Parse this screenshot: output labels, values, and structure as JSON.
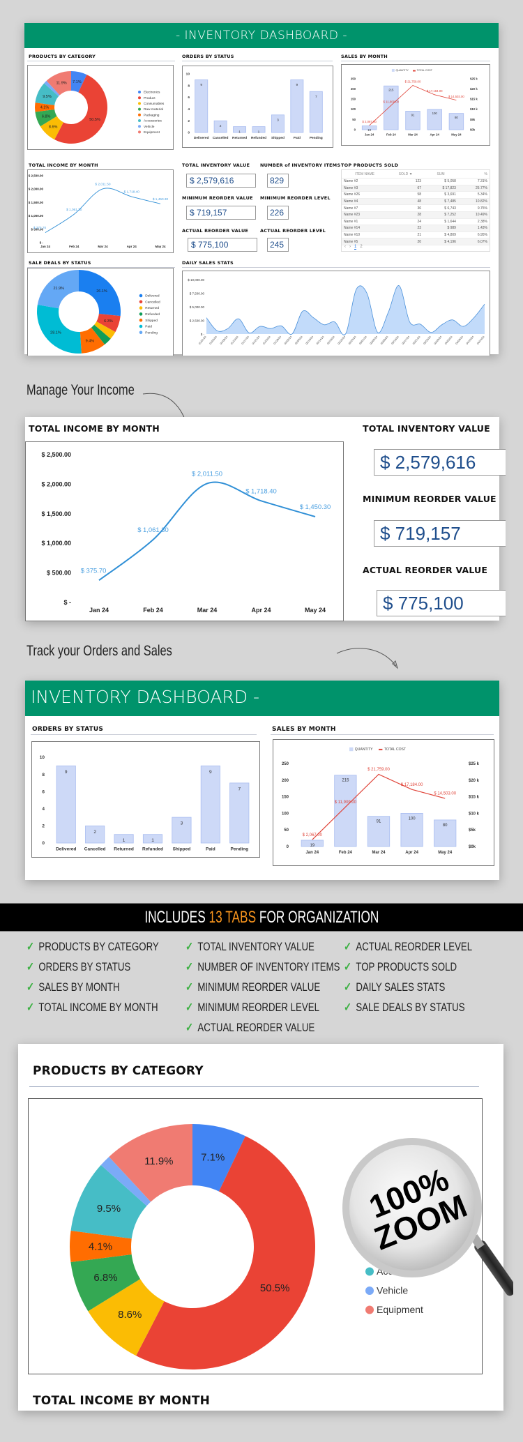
{
  "colors": {
    "brand_green": "#00936b",
    "bar_fill": "#cdd9f7",
    "line_blue": "#2f8fd6",
    "cost_red": "#e0453a",
    "kpi_text": "#1f4e8c",
    "accent_orange": "#f7941d",
    "check_green": "#3cb043"
  },
  "dashboard": {
    "title": "-  INVENTORY DASHBOARD  -",
    "sections": {
      "products_by_category": "PRODUCTS BY CATEGORY",
      "orders_by_status": "ORDERS BY STATUS",
      "sales_by_month": "SALES BY MONTH",
      "total_income_by_month": "TOTAL INCOME BY MONTH",
      "total_inventory_value": "TOTAL INVENTORY VALUE",
      "number_of_inventory_items": "NUMBER of INVENTORY ITEMS",
      "minimum_reorder_value": "MINIMUM REORDER VALUE",
      "minimum_reorder_level": "MINIMUM REORDER LEVEL",
      "actual_reorder_value": "ACTUAL REORDER VALUE",
      "actual_reorder_level": "ACTUAL REORDER LEVEL",
      "top_products_sold": "TOP PRODUCTS SOLD",
      "sale_deals_by_status": "SALE DEALS BY STATUS",
      "daily_sales_stats": "DAILY SALES STATS"
    },
    "kpis": {
      "total_inventory_value": "$ 2,579,616",
      "number_of_inventory_items": "829",
      "minimum_reorder_value": "$ 719,157",
      "minimum_reorder_level": "226",
      "actual_reorder_value": "$ 775,100",
      "actual_reorder_level": "245"
    },
    "top_products": {
      "headers": [
        "ITEM NAME",
        "SOLD ▼",
        "SUM",
        "%"
      ],
      "rows": [
        [
          "Name #2",
          "123",
          "$ 5,058",
          "7.31%"
        ],
        [
          "Name #3",
          "67",
          "$ 17,823",
          "25.77%"
        ],
        [
          "Name #26",
          "58",
          "$ 3,691",
          "5.34%"
        ],
        [
          "Name #4",
          "48",
          "$ 7,485",
          "10.82%"
        ],
        [
          "Name #7",
          "36",
          "$ 6,743",
          "9.75%"
        ],
        [
          "Name #23",
          "28",
          "$ 7,252",
          "10.49%"
        ],
        [
          "Name #1",
          "24",
          "$ 1,644",
          "2.38%"
        ],
        [
          "Name #14",
          "23",
          "$ 989",
          "1.43%"
        ],
        [
          "Name #10",
          "21",
          "$ 4,809",
          "6.95%"
        ],
        [
          "Name #5",
          "20",
          "$ 4,196",
          "6.07%"
        ]
      ],
      "pagination": {
        "prev": "‹",
        "next": "›",
        "pages": [
          "1",
          "2"
        ],
        "current": "1"
      }
    }
  },
  "promo": {
    "manage_caption": "Manage Your Income",
    "track_caption": "Track your Orders and Sales",
    "zoom_title": "INVENTORY DASHBOARD  -",
    "banner": {
      "prefix": "INCLUDES ",
      "highlight": "13 TABS",
      "suffix": " FOR ORGANIZATION"
    },
    "features": [
      [
        "PRODUCTS BY CATEGORY",
        "ORDERS BY STATUS",
        "SALES BY MONTH",
        "TOTAL INCOME BY MONTH"
      ],
      [
        "TOTAL INVENTORY VALUE",
        "NUMBER OF INVENTORY ITEMS",
        "MINIMUM REORDER VALUE",
        "MINIMUM REORDER LEVEL",
        "ACTUAL REORDER VALUE"
      ],
      [
        "ACTUAL REORDER LEVEL",
        "TOP PRODUCTS SOLD",
        "DAILY SALES STATS",
        "SALE DEALS BY STATUS"
      ]
    ],
    "check_glyph": "✓",
    "badge": {
      "line1": "100%",
      "line2": "ZOOM"
    },
    "bottom_title": "TOTAL INCOME BY MONTH"
  },
  "chart_data": [
    {
      "id": "products_by_category",
      "type": "pie",
      "donut": true,
      "title": "PRODUCTS BY CATEGORY",
      "legend_position": "right",
      "categories": [
        "Electronics",
        "Product",
        "Consumables",
        "Raw material",
        "Packaging",
        "Accessories",
        "Vehicle",
        "Equipment"
      ],
      "values": [
        7.1,
        50.5,
        8.6,
        6.8,
        4.1,
        9.5,
        1.5,
        11.9
      ],
      "labels": [
        "7.1%",
        "50.5%",
        "8.6%",
        "6.8%",
        "4.1%",
        "9.5%",
        "",
        "11.9%"
      ],
      "colors": [
        "#4285f4",
        "#ea4335",
        "#fbbc04",
        "#34a853",
        "#ff6d01",
        "#46bdc6",
        "#7baaf7",
        "#f07b72"
      ]
    },
    {
      "id": "orders_by_status",
      "type": "bar",
      "title": "ORDERS BY STATUS",
      "categories": [
        "Delivered",
        "Cancelled",
        "Returned",
        "Refunded",
        "Shipped",
        "Paid",
        "Pending"
      ],
      "values": [
        9,
        2,
        1,
        1,
        3,
        9,
        7
      ],
      "yticks": [
        "0",
        "2",
        "4",
        "6",
        "8",
        "10"
      ],
      "ylim": [
        0,
        10
      ]
    },
    {
      "id": "sales_by_month",
      "type": "bar",
      "title": "SALES BY MONTH",
      "categories": [
        "Jan 24",
        "Feb 24",
        "Mar 24",
        "Apr 24",
        "May 24"
      ],
      "series": [
        {
          "name": "QUANTITY",
          "type": "bar",
          "values": [
            19,
            215,
            91,
            100,
            80
          ],
          "labels": [
            "19",
            "215",
            "91",
            "100",
            "80"
          ]
        },
        {
          "name": "TOTAL COST",
          "type": "line",
          "values": [
            2067,
            11909,
            21759,
            17184,
            14503
          ],
          "labels": [
            "$ 2,067.00",
            "$ 11,909.00",
            "$ 21,759.00",
            "$ 17,184.00",
            "$ 14,503.00"
          ]
        }
      ],
      "yticks_left": [
        "0",
        "50",
        "100",
        "150",
        "200",
        "250"
      ],
      "ylim_left": [
        0,
        250
      ],
      "yticks_right": [
        "$0k",
        "$5k",
        "$10 k",
        "$15 k",
        "$20 k",
        "$25 k"
      ],
      "ylim_right": [
        0,
        25000
      ],
      "legend_position": "top"
    },
    {
      "id": "total_income_by_month",
      "type": "line",
      "title": "TOTAL INCOME BY MONTH",
      "categories": [
        "Jan 24",
        "Feb 24",
        "Mar 24",
        "Apr 24",
        "May 24"
      ],
      "values": [
        375.7,
        1061.3,
        2011.5,
        1718.4,
        1450.3
      ],
      "labels": [
        "$ 375.70",
        "$ 1,061.30",
        "$ 2,011.50",
        "$ 1,718.40",
        "$ 1,450.30"
      ],
      "yticks": [
        "$ -",
        "$ 500.00",
        "$ 1,000.00",
        "$ 1,500.00",
        "$ 2,000.00",
        "$ 2,500.00"
      ],
      "ylim": [
        0,
        2500
      ]
    },
    {
      "id": "sale_deals_by_status",
      "type": "pie",
      "donut": true,
      "title": "SALE DEALS BY STATUS",
      "legend_position": "right",
      "categories": [
        "Delivered",
        "Cancelled",
        "Returned",
        "Refunded",
        "Shipped",
        "Paid",
        "Pending"
      ],
      "values": [
        26.1,
        6.3,
        3.1,
        3.1,
        9.4,
        28.1,
        21.9
      ],
      "labels": [
        "26.1%",
        "6.3%",
        "",
        "",
        "9.4%",
        "28.1%",
        "21.9%"
      ],
      "colors": [
        "#1a7ff0",
        "#ea4335",
        "#fbbc04",
        "#0f9d58",
        "#ff6d01",
        "#00bcd4",
        "#64a8f5"
      ]
    },
    {
      "id": "daily_sales_stats",
      "type": "area",
      "title": "DAILY SALES STATS",
      "values": [
        3000,
        600,
        1000,
        2800,
        200,
        1400,
        1000,
        1500,
        0,
        4200,
        3000,
        1700,
        2200,
        0,
        8200,
        7500,
        300,
        4000,
        8900,
        2200,
        1800,
        300,
        1700,
        2600,
        1400,
        3000,
        5500
      ],
      "x": [
        "01/01/24",
        "01/05/24",
        "01/09/24",
        "01/13/24",
        "01/17/24",
        "01/21/24",
        "01/25/24",
        "01/29/24",
        "02/02/24",
        "02/06/24",
        "02/10/24",
        "02/14/24",
        "02/18/24",
        "02/22/24",
        "02/26/24",
        "03/01/24",
        "03/05/24",
        "03/09/24",
        "03/13/24",
        "03/17/24",
        "03/21/24",
        "03/25/24",
        "03/29/24",
        "04/02/24",
        "04/06/24",
        "04/10/24",
        "04/14/24"
      ],
      "yticks": [
        "$ -",
        "$ 2,500.00",
        "$ 5,000.00",
        "$ 7,500.00",
        "$ 10,000.00"
      ],
      "ylim": [
        0,
        10000
      ]
    }
  ]
}
